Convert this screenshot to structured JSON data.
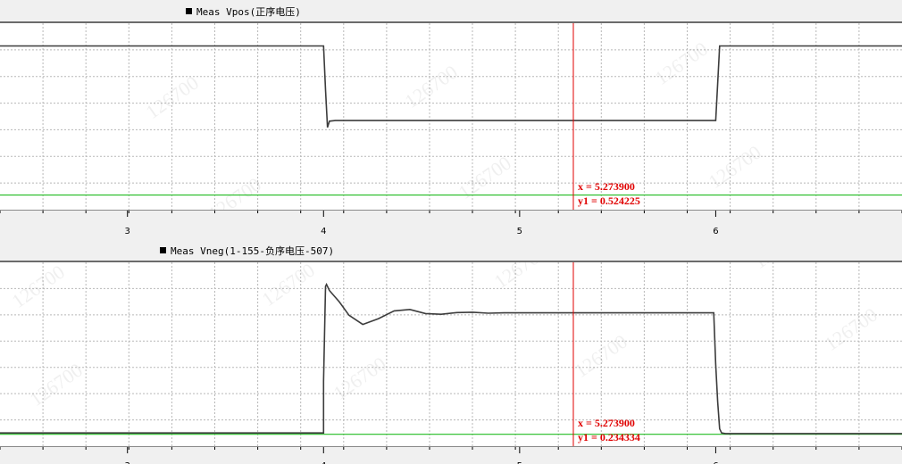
{
  "panels": [
    {
      "title": "Meas Vpos(正序电压)",
      "cursor": {
        "x_label": "x = 5.273900",
        "y_label": "y1 = 0.524225"
      }
    },
    {
      "title": "Meas Vneg(1-155-负序电压-507)",
      "cursor": {
        "x_label": "x = 5.273900",
        "y_label": "y1 = 0.234334"
      }
    }
  ],
  "watermark_text": "126700",
  "colors": {
    "trace": "#3c3c3c",
    "cursor": "#e00000",
    "baseline": "#22bb22",
    "grid": "#b8b8b8"
  },
  "chart_data": [
    {
      "type": "line",
      "title": "Meas Vpos(正序电压)",
      "xlim": [
        2.35,
        6.95
      ],
      "ylim": [
        0.5,
        1.05
      ],
      "x_ticks": [
        3,
        4,
        5,
        6
      ],
      "grid": true,
      "cursor_x": 5.2739,
      "baseline_y": 0.524,
      "series": [
        {
          "x": [
            2.35,
            4.0,
            4.01,
            4.02,
            4.03,
            4.06,
            6.0,
            6.01,
            6.02,
            6.04,
            6.95
          ],
          "y": [
            1.0,
            1.0,
            0.86,
            0.74,
            0.76,
            0.762,
            0.762,
            0.88,
            1.0,
            1.0,
            1.0
          ]
        }
      ]
    },
    {
      "type": "line",
      "title": "Meas Vneg(1-155-负序电压-507)",
      "xlim": [
        2.35,
        6.95
      ],
      "ylim": [
        0.22,
        0.72
      ],
      "x_ticks": [
        3,
        4,
        5,
        6
      ],
      "grid": true,
      "cursor_x": 5.2739,
      "baseline_y": 0.234,
      "series": [
        {
          "x": [
            2.35,
            4.0,
            4.0,
            4.01,
            4.015,
            4.03,
            4.08,
            4.13,
            4.2,
            4.28,
            4.36,
            4.44,
            4.52,
            4.6,
            4.68,
            4.76,
            4.84,
            4.92,
            5.0,
            5.5,
            5.99,
            6.0,
            6.01,
            6.02,
            6.03,
            6.05,
            6.95
          ],
          "y": [
            0.238,
            0.238,
            0.39,
            0.67,
            0.676,
            0.658,
            0.625,
            0.585,
            0.558,
            0.575,
            0.598,
            0.602,
            0.59,
            0.588,
            0.593,
            0.594,
            0.591,
            0.592,
            0.592,
            0.592,
            0.592,
            0.44,
            0.33,
            0.25,
            0.238,
            0.236,
            0.236
          ]
        }
      ]
    }
  ]
}
